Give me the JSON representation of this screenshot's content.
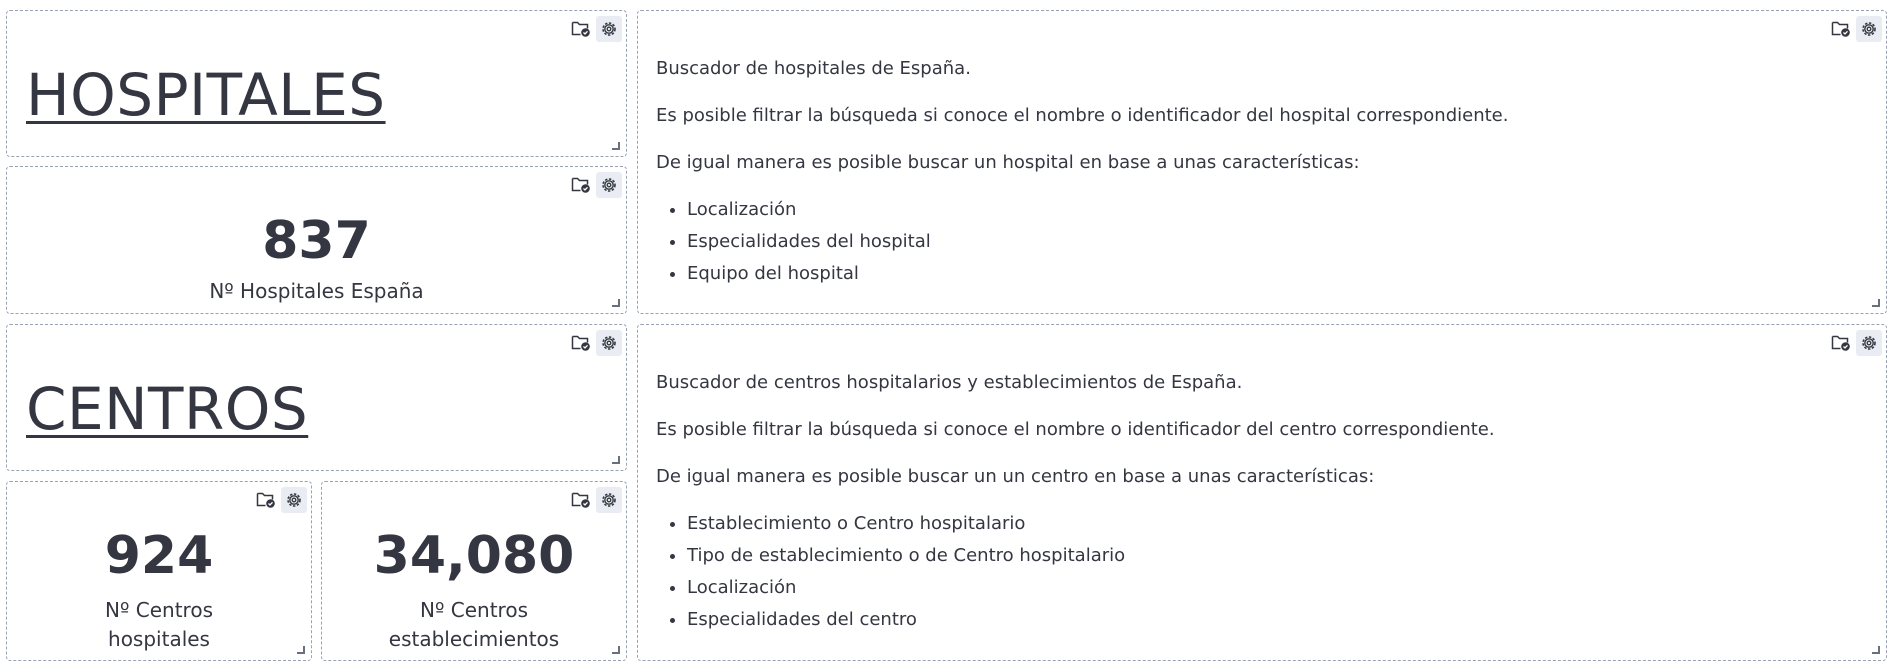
{
  "panel_actions": {
    "folder_icon": "folder-check-icon",
    "gear_icon": "gear-icon"
  },
  "hospitales": {
    "title": "HOSPITALES",
    "metric_value": "837",
    "metric_label": "Nº Hospitales España",
    "description": {
      "p1": "Buscador de hospitales de España.",
      "p2": "Es posible filtrar la búsqueda si conoce el nombre o identificador del hospital correspondiente.",
      "p3": "De igual manera es posible buscar un hospital en base a unas características:",
      "items": [
        "Localización",
        "Especialidades del hospital",
        "Equipo del hospital"
      ]
    }
  },
  "centros": {
    "title": "CENTROS",
    "metric_hosp_value": "924",
    "metric_hosp_label": "Nº Centros hospitales",
    "metric_est_value": "34,080",
    "metric_est_label": "Nº Centros establecimientos",
    "description": {
      "p1": "Buscador de centros hospitalarios y establecimientos de España.",
      "p2": "Es posible filtrar la búsqueda si conoce el nombre o identificador del centro correspondiente.",
      "p3": "De igual manera es posible buscar un un centro en base a unas características:",
      "items": [
        "Establecimiento o Centro hospitalario",
        "Tipo de establecimiento o de Centro hospitalario",
        "Localización",
        "Especialidades del centro"
      ]
    }
  }
}
